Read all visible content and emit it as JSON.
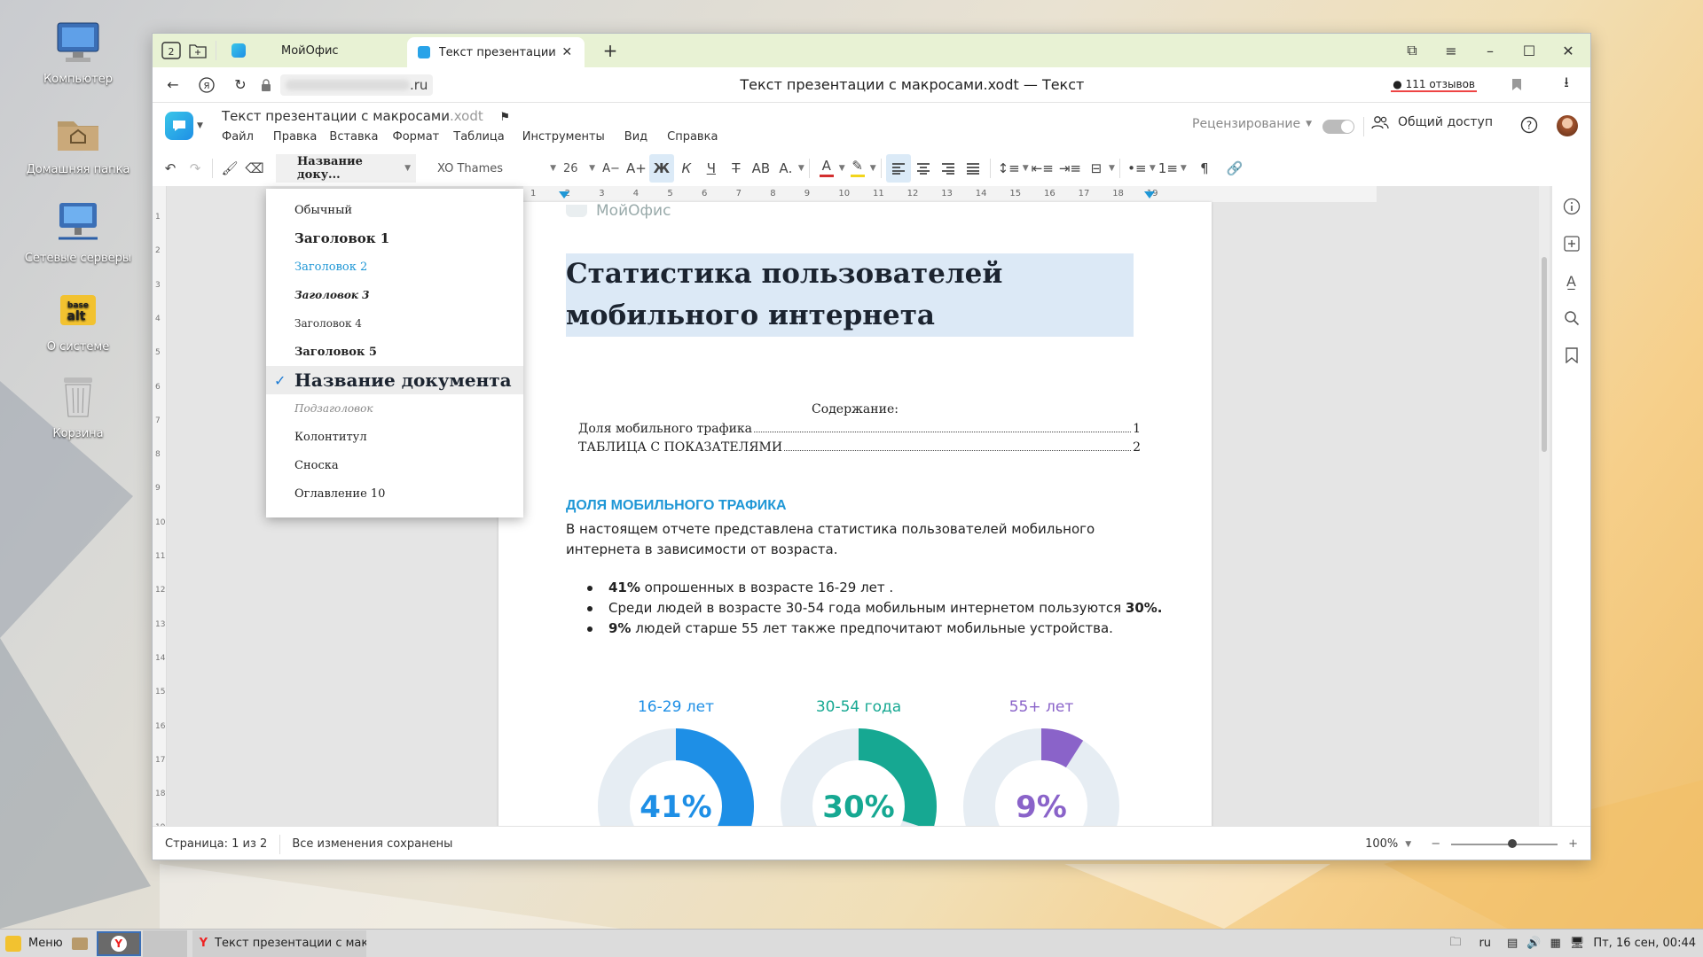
{
  "desktop": {
    "icons": [
      {
        "label": "Компьютер",
        "icon": "computer-icon"
      },
      {
        "label": "Домашняя папка",
        "icon": "home-folder-icon"
      },
      {
        "label": "Сетевые серверы",
        "icon": "network-servers-icon"
      },
      {
        "label": "О системе",
        "icon": "about-system-icon",
        "logo_text": "base alt"
      },
      {
        "label": "Корзина",
        "icon": "trash-icon"
      }
    ]
  },
  "browser": {
    "tab_counter": "2",
    "tabs": [
      {
        "label": "МойОфис",
        "active": false
      },
      {
        "label": "Текст презентации с м",
        "active": true
      }
    ],
    "address": ".ru",
    "page_title": "Текст презентации с макросами.xodt — Текст",
    "reviews": "111 отзывов"
  },
  "app": {
    "doc_name": "Текст презентации с макросами",
    "doc_ext": ".xodt",
    "menu": [
      "Файл",
      "Правка",
      "Вставка",
      "Формат",
      "Таблица",
      "Инструменты",
      "Вид",
      "Справка"
    ],
    "review_mode": "Рецензирование",
    "share_label": "Общий доступ"
  },
  "toolbar": {
    "style_value": "Название доку...",
    "font_name": "XO Thames",
    "font_size": "26",
    "bold_glyph": "Ж",
    "italic_glyph": "К",
    "underline_glyph": "Ч",
    "strike_glyph": "Т",
    "caps_glyph": "АВ",
    "sub_glyph": "А.",
    "color_glyph": "А",
    "decrease_font": "А−",
    "increase_font": "А+",
    "pilcrow": "¶"
  },
  "style_dropdown": {
    "items": [
      {
        "label": "Обычный",
        "selected": false
      },
      {
        "label": "Заголовок 1",
        "selected": false
      },
      {
        "label": "Заголовок 2",
        "selected": false
      },
      {
        "label": "Заголовок 3",
        "selected": false
      },
      {
        "label": "Заголовок 4",
        "selected": false
      },
      {
        "label": "Заголовок 5",
        "selected": false
      },
      {
        "label": "Название документа",
        "selected": true
      },
      {
        "label": "Подзаголовок",
        "selected": false
      },
      {
        "label": "Колонтитул",
        "selected": false
      },
      {
        "label": "Сноска",
        "selected": false
      },
      {
        "label": "Оглавление 10",
        "selected": false
      }
    ]
  },
  "ruler": {
    "h_ticks": [
      "1",
      "2",
      "3",
      "4",
      "5",
      "6",
      "7",
      "8",
      "9",
      "10",
      "11",
      "12",
      "13",
      "14",
      "15",
      "16",
      "17",
      "18",
      "19"
    ],
    "v_ticks": [
      "1",
      "2",
      "3",
      "4",
      "5",
      "6",
      "7",
      "8",
      "9",
      "10",
      "11",
      "12",
      "13",
      "14",
      "15",
      "16",
      "17",
      "18",
      "19"
    ]
  },
  "document": {
    "logo_text": "МойОфис",
    "title": "Статистика пользователей мобильного интернета",
    "toc_title": "Содержание:",
    "toc": [
      {
        "text": "Доля мобильного трафика",
        "page": "1"
      },
      {
        "text": "ТАБЛИЦА С ПОКАЗАТЕЛЯМИ",
        "page": "2"
      }
    ],
    "section_heading": "ДОЛЯ МОБИЛЬНОГО ТРАФИКА",
    "paragraph": "В настоящем отчете представлена статистика пользователей мобильного интернета в зависимости от возраста.",
    "bullets": [
      {
        "bold": "41%",
        "text": " опрошенных в возрасте 16-29 лет ."
      },
      {
        "text": "Среди людей в возрасте 30-54 года мобильным интернетом пользуются ",
        "bold_end": "30%."
      },
      {
        "bold": "9%",
        "text": " людей старше 55 лет также предпочитают мобильные устройства."
      }
    ],
    "donuts": [
      {
        "label": "16-29 лет",
        "value": "41%",
        "fraction": 0.41,
        "color": "#1e8fe6"
      },
      {
        "label": "30-54 года",
        "value": "30%",
        "fraction": 0.3,
        "color": "#16a892"
      },
      {
        "label": "55+ лет",
        "value": "9%",
        "fraction": 0.09,
        "color": "#8a63c9"
      }
    ]
  },
  "status": {
    "page": "Страница: 1 из 2",
    "saved": "Все изменения сохранены",
    "zoom": "100%"
  },
  "taskbar": {
    "menu_label": "Меню",
    "window_label": "Текст презентации с мак...",
    "lang": "ru",
    "clock": "Пт, 16 сен, 00:44"
  }
}
